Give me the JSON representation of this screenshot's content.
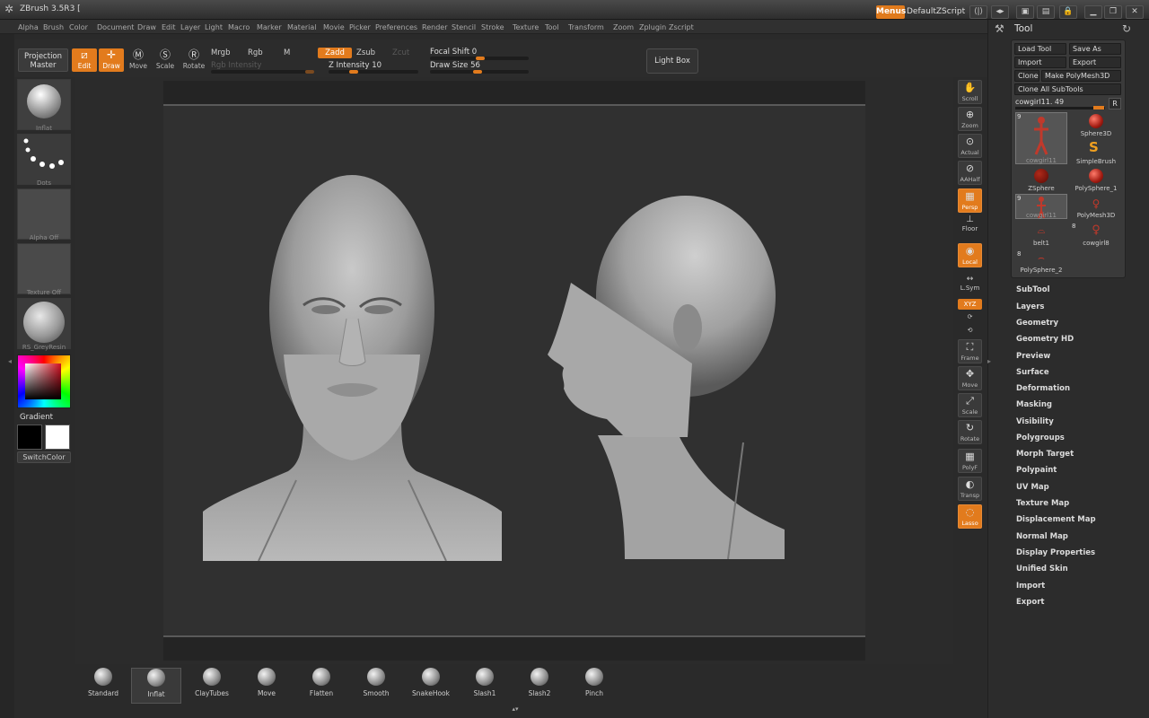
{
  "titlebar": {
    "title": "ZBrush 3.5R3 [",
    "menus_button": "Menus",
    "zscript_label": "DefaultZScript"
  },
  "menubar": [
    "Alpha",
    "Brush",
    "Color",
    "Document",
    "Draw",
    "Edit",
    "Layer",
    "Light",
    "Macro",
    "Marker",
    "Material",
    "Movie",
    "Picker",
    "Preferences",
    "Render",
    "Stencil",
    "Stroke",
    "Texture",
    "Tool",
    "Transform",
    "Zoom",
    "Zplugin",
    "Zscript"
  ],
  "toolbar": {
    "projection_master": [
      "Projection",
      "Master"
    ],
    "edit": "Edit",
    "draw": "Draw",
    "move": "Move",
    "scale": "Scale",
    "rotate": "Rotate",
    "mrgb": "Mrgb",
    "rgb": "Rgb",
    "m": "M",
    "zadd": "Zadd",
    "zsub": "Zsub",
    "zcut": "Zcut",
    "rgb_intensity": "Rgb Intensity",
    "z_intensity_label": "Z Intensity",
    "z_intensity_value": "10",
    "focal_shift_label": "Focal Shift",
    "focal_shift_value": "0",
    "draw_size_label": "Draw Size",
    "draw_size_value": "56",
    "light_box": "Light Box"
  },
  "left_shelf": {
    "thumbs": [
      "Inflat",
      "Dots",
      "Alpha Off",
      "Texture Off",
      "RS_GreyResin"
    ],
    "gradient": "Gradient",
    "switch_color": "SwitchColor",
    "primary_color": "#000000",
    "secondary_color": "#ffffff"
  },
  "right_shelf": [
    {
      "label": "Scroll",
      "icon": "hand-icon"
    },
    {
      "label": "Zoom",
      "icon": "zoom-icon"
    },
    {
      "label": "Actual",
      "icon": "actual-icon"
    },
    {
      "label": "AAHalf",
      "icon": "aahalf-icon"
    },
    {
      "label": "Persp",
      "icon": "persp-icon"
    },
    {
      "label": "Floor",
      "icon": "floor-icon"
    },
    {
      "label": "Local",
      "icon": "local-icon"
    },
    {
      "label": "L.Sym",
      "icon": "lsym-icon"
    },
    {
      "label": "XYZ",
      "icon": "xyz-icon"
    },
    {
      "label": "Frame",
      "icon": "frame-icon"
    },
    {
      "label": "Move",
      "icon": "move-icon"
    },
    {
      "label": "Scale",
      "icon": "scale-icon"
    },
    {
      "label": "Rotate",
      "icon": "rotate-icon"
    },
    {
      "label": "PolyF",
      "icon": "polyf-icon"
    },
    {
      "label": "Transp",
      "icon": "transp-icon"
    },
    {
      "label": "Lasso",
      "icon": "lasso-icon"
    }
  ],
  "tool_panel": {
    "title": "Tool",
    "load_tool": "Load Tool",
    "save_as": "Save As",
    "import": "Import",
    "export": "Export",
    "clone": "Clone",
    "make_polymesh": "Make PolyMesh3D",
    "clone_all": "Clone All SubTools",
    "slider_label": "cowgirl11. 49",
    "r_button": "R",
    "items": {
      "cowgirl11_a": "cowgirl11",
      "sphere3d": "Sphere3D",
      "simplebrush": "SimpleBrush",
      "zsphere": "ZSphere",
      "polysphere1": "PolySphere_1",
      "cowgirl11_b": "cowgirl11",
      "polymesh3d": "PolyMesh3D",
      "belt1": "belt1",
      "cowgirl8": "cowgirl8",
      "polysphere2": "PolySphere_2"
    },
    "counts": {
      "c1": "9",
      "c2": "9",
      "c3": "8",
      "c4": "8"
    },
    "sections": [
      "SubTool",
      "Layers",
      "Geometry",
      "Geometry HD",
      "Preview",
      "Surface",
      "Deformation",
      "Masking",
      "Visibility",
      "Polygroups",
      "Morph Target",
      "Polypaint",
      "UV Map",
      "Texture Map",
      "Displacement Map",
      "Normal Map",
      "Display Properties",
      "Unified Skin",
      "Import",
      "Export"
    ]
  },
  "brushes": [
    "Standard",
    "Inflat",
    "ClayTubes",
    "Move",
    "Flatten",
    "Smooth",
    "SnakeHook",
    "Slash1",
    "Slash2",
    "Pinch"
  ],
  "accent_color": "#e27b1d"
}
